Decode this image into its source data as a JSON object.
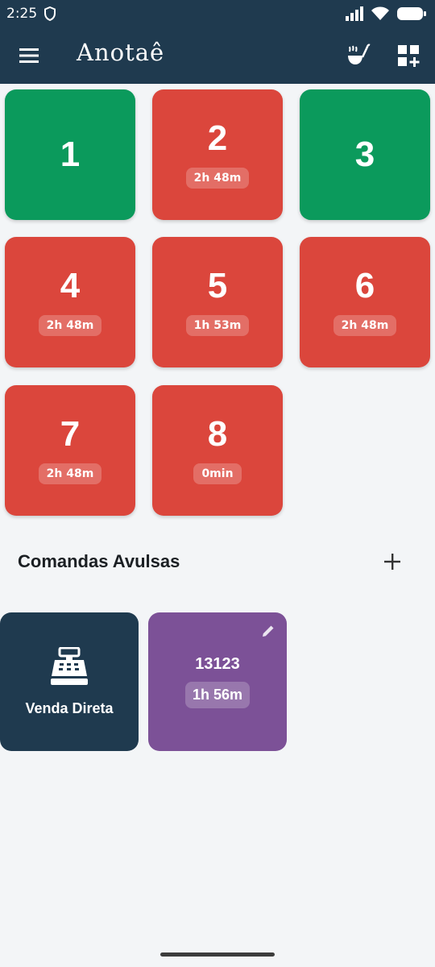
{
  "status": {
    "time": "2:25"
  },
  "app": {
    "title": "Anotaê"
  },
  "tables": [
    {
      "number": "1",
      "state": "free",
      "time": ""
    },
    {
      "number": "2",
      "state": "busy",
      "time": "2h 48m"
    },
    {
      "number": "3",
      "state": "free",
      "time": ""
    },
    {
      "number": "4",
      "state": "busy",
      "time": "2h 48m"
    },
    {
      "number": "5",
      "state": "busy",
      "time": "1h 53m"
    },
    {
      "number": "6",
      "state": "busy",
      "time": "2h 48m"
    },
    {
      "number": "7",
      "state": "busy",
      "time": "2h 48m"
    },
    {
      "number": "8",
      "state": "busy",
      "time": "0min"
    }
  ],
  "section": {
    "title": "Comandas Avulsas"
  },
  "direct_sale": {
    "label": "Venda Direta"
  },
  "comanda": {
    "id": "13123",
    "time": "1h 56m"
  },
  "colors": {
    "header": "#1f3a4f",
    "free": "#0b9a5c",
    "busy": "#db463c",
    "comanda": "#7c5197",
    "background": "#f3f5f7"
  },
  "icons": {
    "menu": "menu-icon",
    "ladle": "ladle-icon",
    "grid_add": "grid-add-icon",
    "add": "plus-icon",
    "register": "cash-register-icon",
    "edit": "pencil-icon"
  }
}
